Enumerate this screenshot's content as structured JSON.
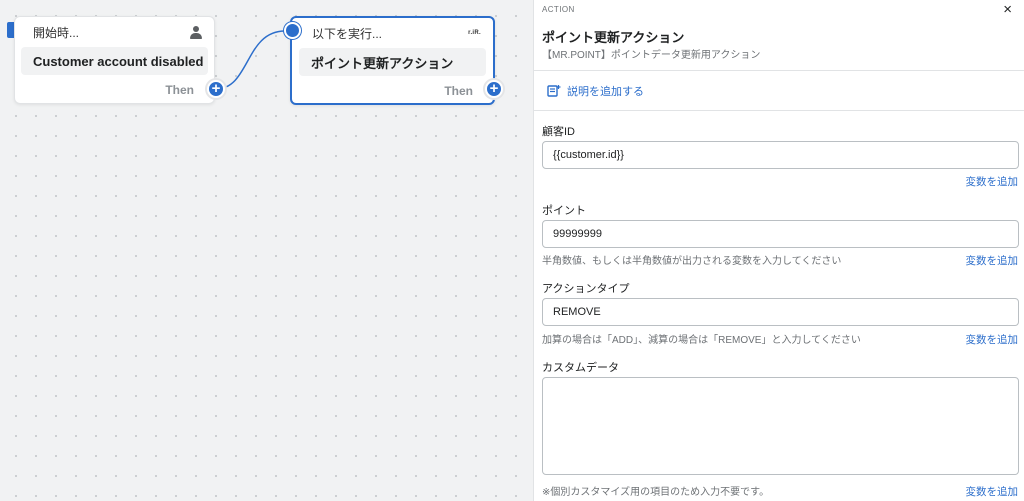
{
  "canvas": {
    "trigger_node": {
      "header": "開始時...",
      "body": "Customer account disabled",
      "footer": "Then"
    },
    "action_node": {
      "header": "以下を実行...",
      "app_mark": "r.iR.",
      "body": "ポイント更新アクション",
      "footer": "Then"
    }
  },
  "panel": {
    "overline": "ACTION",
    "close_symbol": "×",
    "title": "ポイント更新アクション",
    "subtitle": "【MR.POINT】ポイントデータ更新用アクション",
    "add_description": "説明を追加する",
    "fields": [
      {
        "label": "顧客ID",
        "value": "{{customer.id}}",
        "help": "",
        "add_variable": "変数を追加"
      },
      {
        "label": "ポイント",
        "value": "99999999",
        "help": "半角数値、もしくは半角数値が出力される変数を入力してください",
        "add_variable": "変数を追加"
      },
      {
        "label": "アクションタイプ",
        "value": "REMOVE",
        "help": "加算の場合は「ADD」、減算の場合は「REMOVE」と入力してください",
        "add_variable": "変数を追加"
      },
      {
        "label": "カスタムデータ",
        "value": "",
        "help": "※個別カスタマイズ用の項目のため入力不要です。",
        "add_variable": "変数を追加"
      }
    ]
  },
  "colors": {
    "accent": "#2c6ecb",
    "canvas_bg": "#f1f2f3",
    "text": "#202223",
    "muted": "#6d7175"
  },
  "icons": [
    "trigger-marker-icon",
    "person-icon",
    "plus-icon",
    "close-icon",
    "add-description-icon"
  ]
}
